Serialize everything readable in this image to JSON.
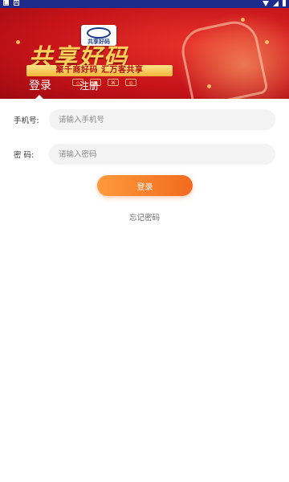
{
  "banner": {
    "logo_text": "共享好码",
    "title": "共享好码",
    "subtitle": "聚千商好码  汇万客共享"
  },
  "tabs": [
    {
      "label": "登录",
      "active": true
    },
    {
      "label": "注册",
      "active": false
    }
  ],
  "form": {
    "phone": {
      "label": "手机号:",
      "placeholder": "请输入手机号",
      "value": ""
    },
    "password": {
      "label": "密  码:",
      "placeholder": "请输入密码",
      "value": ""
    },
    "login_button": "登录",
    "forgot_link": "忘记密码"
  },
  "colors": {
    "status_bar": "#1e2a8c",
    "banner_red": "#c8141a",
    "accent_orange": "#f26a1f",
    "title_gold": "#ffd25a"
  }
}
